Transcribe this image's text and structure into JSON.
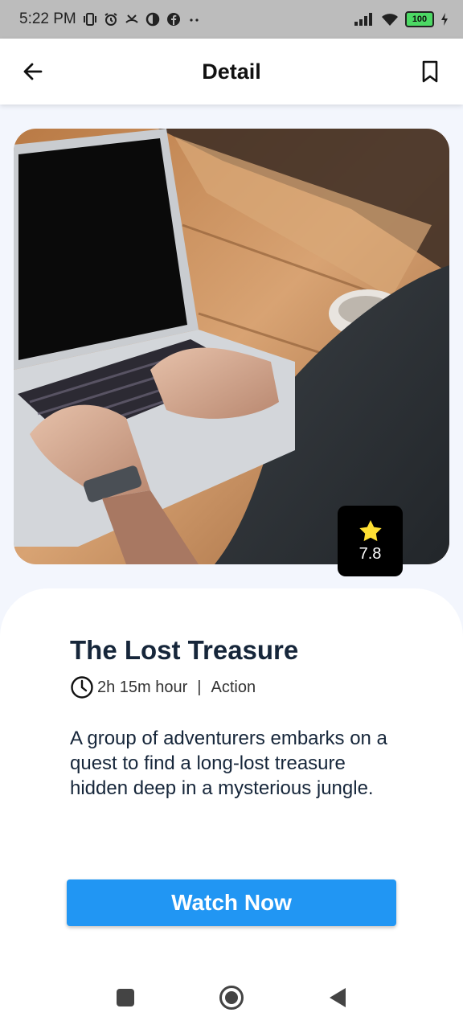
{
  "status_bar": {
    "time": "5:22 PM",
    "battery": "100",
    "icons": [
      "vibrate-icon",
      "alarm-icon",
      "missed-call-icon",
      "data-saver-icon",
      "facebook-icon",
      "more-dots-icon",
      "signal-icon",
      "wifi-icon",
      "battery-icon",
      "charging-icon"
    ]
  },
  "app_bar": {
    "title": "Detail",
    "back_icon": "arrow-left-icon",
    "bookmark_icon": "bookmark-outline-icon"
  },
  "poster": {
    "description_icon": "laptop-photo",
    "rating": "7.8",
    "rating_icon": "star-icon",
    "star_color": "#ffe033"
  },
  "movie": {
    "title": "The Lost Treasure",
    "duration": "2h 15m hour",
    "separator": "|",
    "genre": "Action",
    "description": "A group of adventurers embarks on a quest to find a long-lost treasure hidden deep in a mysterious jungle."
  },
  "actions": {
    "watch_label": "Watch Now"
  },
  "colors": {
    "accent": "#2196f3",
    "background": "#f3f6fd",
    "title_text": "#16263a"
  },
  "nav_bar": {
    "buttons": [
      "recents-square-icon",
      "home-circle-icon",
      "back-triangle-icon"
    ]
  }
}
